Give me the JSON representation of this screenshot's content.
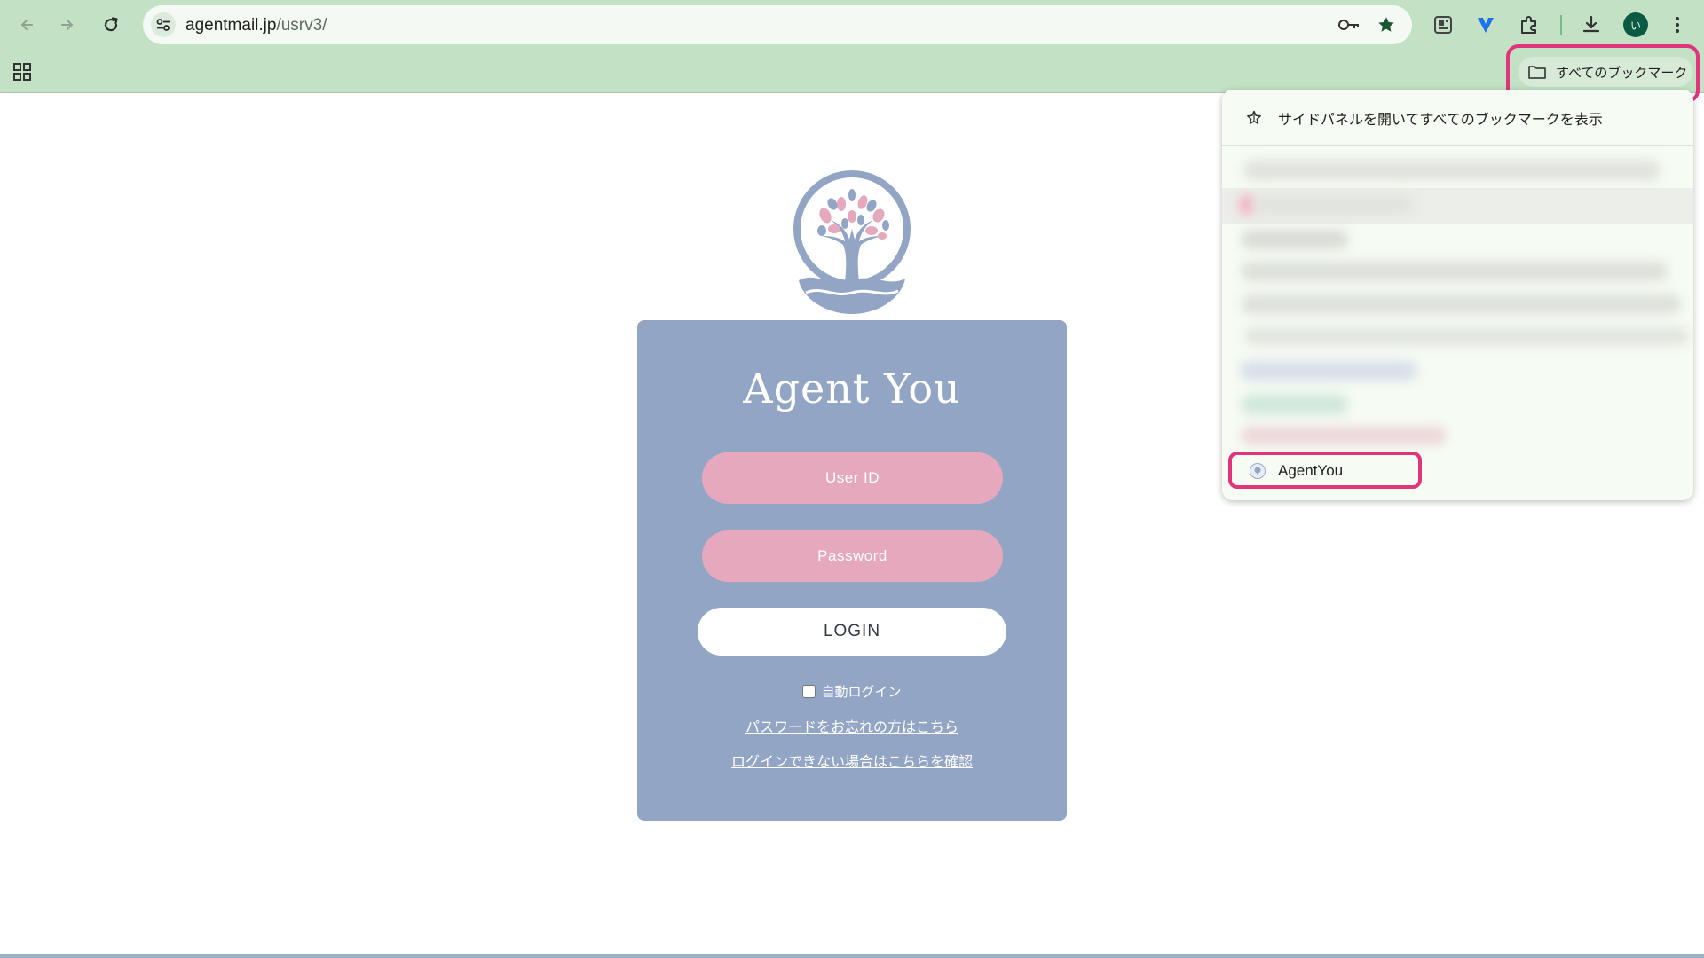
{
  "browser": {
    "url_host": "agentmail.jp",
    "url_path": "/usrv3/",
    "avatar_initial": "い",
    "icons": {
      "back": "arrow-left-icon",
      "forward": "arrow-right-icon",
      "reload": "reload-icon",
      "site_settings": "tune-icon",
      "password": "key-icon",
      "bookmark": "star-filled-icon",
      "reading": "reading-list-icon",
      "extension_v": "v-extension-icon",
      "extensions": "puzzle-icon",
      "downloads": "download-icon",
      "menu": "more-vert-icon",
      "apps": "apps-grid-icon"
    },
    "bookmarks_bar": {
      "all_bookmarks_label": "すべてのブックマーク"
    }
  },
  "bookmark_menu": {
    "open_side_panel_label": "サイドパネルを開いてすべてのブックマークを表示",
    "items": [
      {
        "label": "AgentYou"
      }
    ]
  },
  "login": {
    "brand": "Agent You",
    "user_id_placeholder": "User ID",
    "password_placeholder": "Password",
    "login_label": "LOGIN",
    "auto_login_label": "自動ログイン",
    "forgot_password_link": "パスワードをお忘れの方はこちら",
    "cannot_login_link": "ログインできない場合はこちらを確認"
  },
  "colors": {
    "chrome": "#c3e2c5",
    "card": "#93a5c5",
    "field": "#e6a8bd",
    "highlight": "#e0357a"
  }
}
